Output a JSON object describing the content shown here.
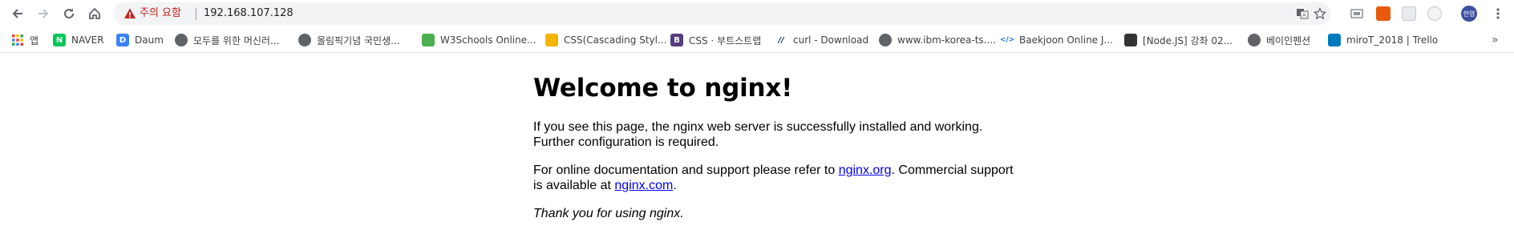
{
  "toolbar": {
    "back_icon": "back-arrow-icon",
    "forward_icon": "forward-arrow-icon",
    "reload_icon": "reload-icon",
    "home_icon": "home-icon",
    "security_warning": "주의 요함",
    "url": "192.168.107.128",
    "profile_label": "한영"
  },
  "bookmarks": [
    {
      "label": "앱",
      "icon": "apps-grid-icon",
      "color": "#ea4335"
    },
    {
      "label": "NAVER",
      "icon": "naver-icon",
      "color": "#03c75a"
    },
    {
      "label": "Daum",
      "icon": "daum-icon",
      "color": "#3b82f6"
    },
    {
      "label": "모두를 위한 머신러...",
      "icon": "globe-icon",
      "color": "#5f6368"
    },
    {
      "label": "올림픽기념 국민생...",
      "icon": "globe-icon",
      "color": "#5f6368"
    },
    {
      "label": "W3Schools Online...",
      "icon": "w3schools-icon",
      "color": "#4caf50"
    },
    {
      "label": "CSS(Cascading Styl...",
      "icon": "document-icon",
      "color": "#f4b400"
    },
    {
      "label": "CSS · 부트스트랩",
      "icon": "bootstrap-icon",
      "color": "#563d7c"
    },
    {
      "label": "curl - Download",
      "icon": "curl-icon",
      "color": "#073551"
    },
    {
      "label": "www.ibm-korea-ts....",
      "icon": "globe-icon",
      "color": "#5f6368"
    },
    {
      "label": "Baekjoon Online J...",
      "icon": "code-icon",
      "color": "#1a73e8"
    },
    {
      "label": "[Node.JS] 강좌 02...",
      "icon": "blog-icon",
      "color": "#333333"
    },
    {
      "label": "베이인펜션",
      "icon": "globe-icon",
      "color": "#5f6368"
    },
    {
      "label": "miroT_2018 | Trello",
      "icon": "trello-icon",
      "color": "#0079bf"
    }
  ],
  "page": {
    "heading": "Welcome to nginx!",
    "p1": "If you see this page, the nginx web server is successfully installed and working. Further configuration is required.",
    "p2_pre": "For online documentation and support please refer to ",
    "p2_link1": "nginx.org",
    "p2_mid": ". Commercial support is available at ",
    "p2_link2": "nginx.com",
    "p2_post": ".",
    "p3": "Thank you for using nginx."
  },
  "colors": {
    "link": "#0000ee",
    "warning": "#c5221f",
    "omnibox_bg": "#f1f3f4"
  }
}
